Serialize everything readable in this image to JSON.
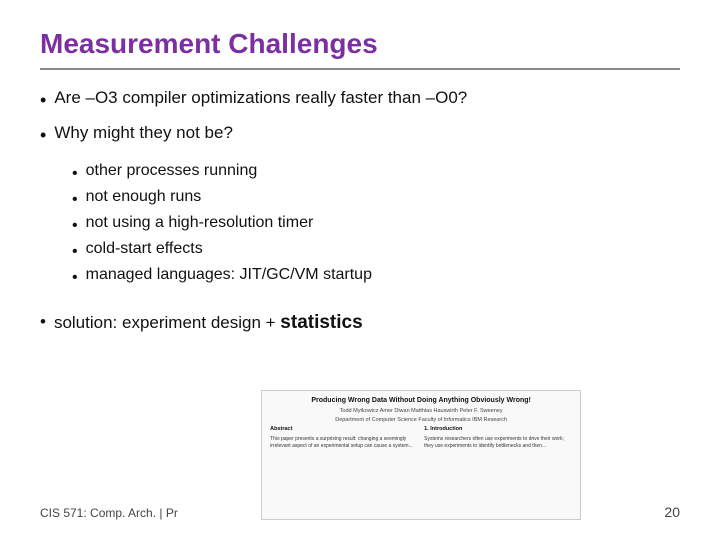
{
  "slide": {
    "title": "Measurement Challenges",
    "bullets": [
      {
        "text": "Are –O3 compiler optimizations really faster than –O0?",
        "sub_bullets": []
      },
      {
        "text": "Why might they not be?",
        "sub_bullets": [
          "other processes running",
          "not enough runs",
          "not using a high-resolution timer",
          "cold-start effects",
          "managed languages: JIT/GC/VM startup"
        ]
      }
    ],
    "solution": {
      "prefix": "solution: experiment design + ",
      "bold": "statistics"
    }
  },
  "footer": {
    "left": "CIS 571: Comp. Arch.  |  Pr",
    "page": "20"
  },
  "paper": {
    "title": "Producing Wrong Data Without Doing Anything Obviously Wrong!",
    "authors": "Todd Mytkowicz  Amer Diwan          Matthias Hauswirth          Peter F. Sweeney",
    "author_affiliations": "Department of Computer Science    Faculty of Informatics          IBM Research",
    "abstract_header": "Abstract",
    "abstract_text": "This paper presents a surprising result: changing a seemingly irrelevant aspect of an experimental setup can cause a system...",
    "intro_header": "1. Introduction",
    "intro_text": "Systems researchers often use experiments to drive their work; they use experiments to identify bottlenecks and then..."
  }
}
